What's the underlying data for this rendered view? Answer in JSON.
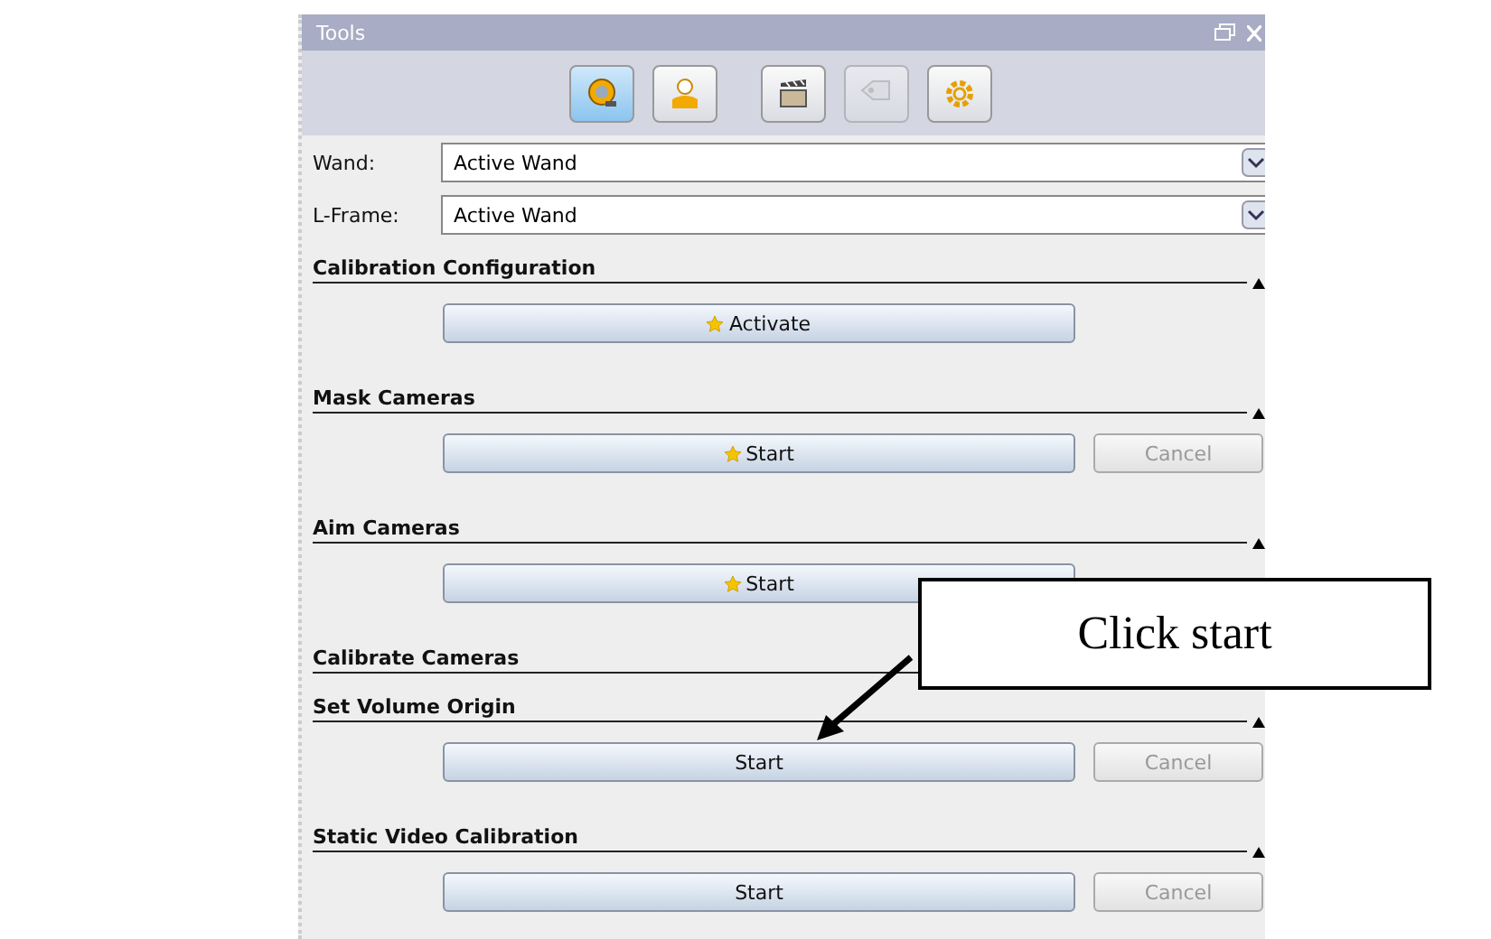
{
  "window": {
    "title": "Tools"
  },
  "toolbar": [
    {
      "kind": "tape",
      "selected": true,
      "disabled": false
    },
    {
      "kind": "person",
      "selected": false,
      "disabled": false
    },
    {
      "kind": "clapper",
      "selected": false,
      "disabled": false
    },
    {
      "kind": "tag",
      "selected": false,
      "disabled": true
    },
    {
      "kind": "gear",
      "selected": false,
      "disabled": false
    }
  ],
  "fields": [
    {
      "label": "Wand:",
      "value": "Active Wand"
    },
    {
      "label": "L-Frame:",
      "value": "Active Wand"
    }
  ],
  "sections": [
    {
      "title": "Calibration Configuration",
      "collapse_icon": true,
      "main": {
        "label": "Activate",
        "star": true
      }
    },
    {
      "title": "Mask Cameras",
      "collapse_icon": true,
      "main": {
        "label": "Start",
        "star": true
      },
      "cancel": "Cancel"
    },
    {
      "title": "Aim Cameras",
      "collapse_icon": true,
      "main": {
        "label": "Start",
        "star": true
      }
    },
    {
      "title": "Calibrate Cameras"
    },
    {
      "title": "Set Volume Origin",
      "collapse_icon": true,
      "main": {
        "label": "Start",
        "star": false
      },
      "cancel": "Cancel"
    },
    {
      "title": "Static Video Calibration",
      "collapse_icon": true,
      "main": {
        "label": "Start",
        "star": false
      },
      "cancel": "Cancel"
    }
  ],
  "callout": {
    "text": "Click start"
  }
}
